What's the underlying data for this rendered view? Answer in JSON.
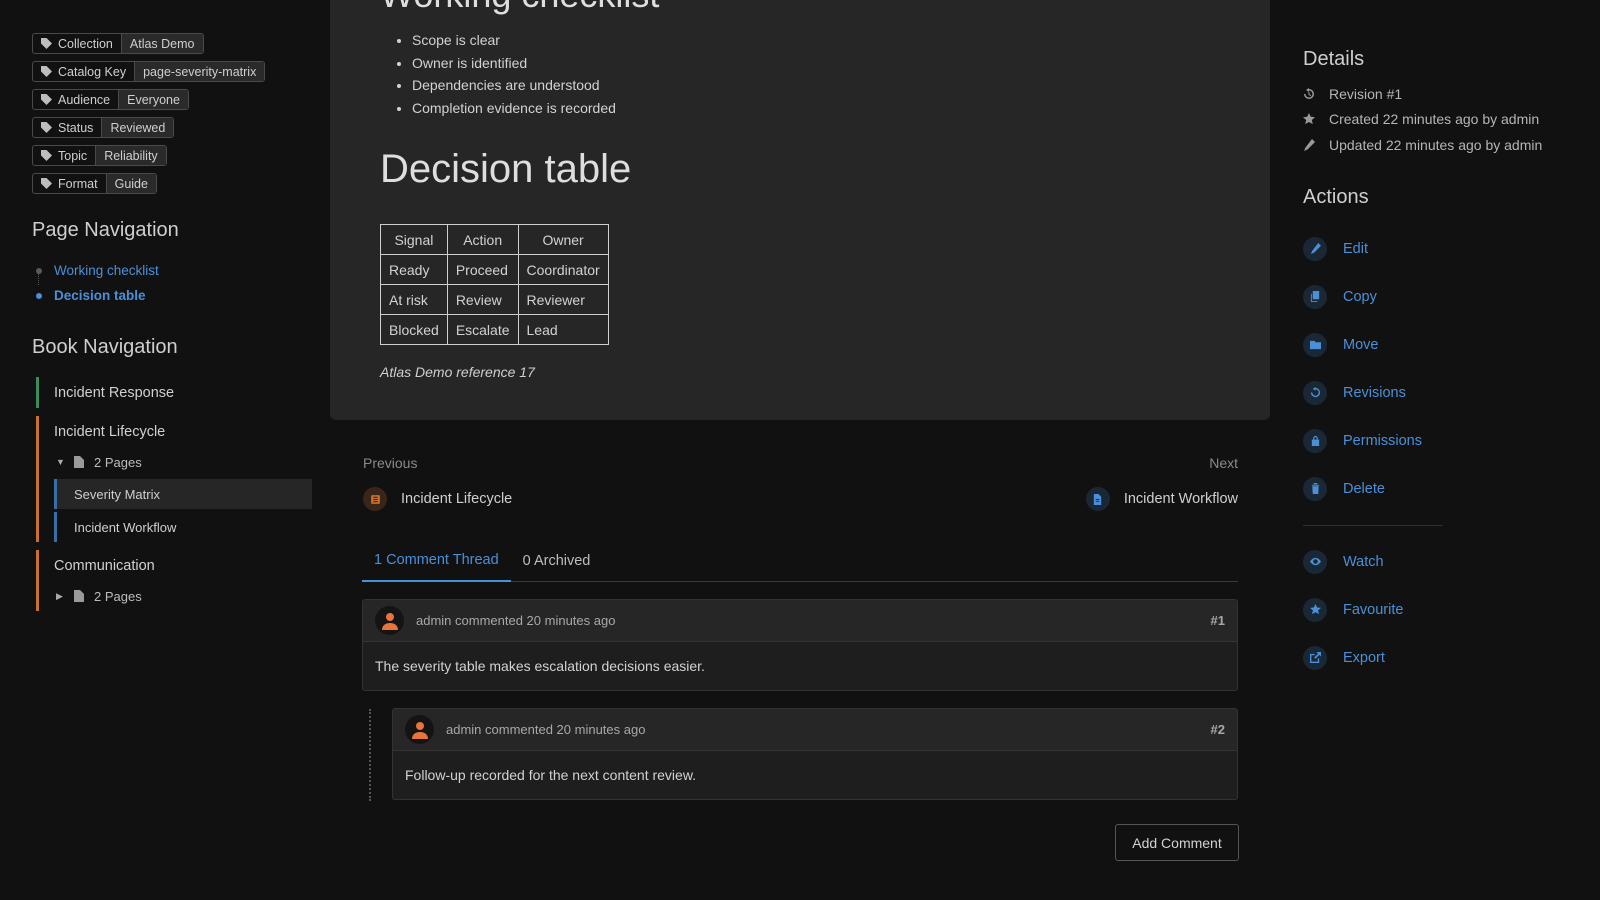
{
  "tags": [
    {
      "name": "Collection",
      "value": "Atlas Demo"
    },
    {
      "name": "Catalog Key",
      "value": "page-severity-matrix"
    },
    {
      "name": "Audience",
      "value": "Everyone"
    },
    {
      "name": "Status",
      "value": "Reviewed"
    },
    {
      "name": "Topic",
      "value": "Reliability"
    },
    {
      "name": "Format",
      "value": "Guide"
    }
  ],
  "page_navigation": {
    "heading": "Page Navigation",
    "items": [
      {
        "label": "Working checklist",
        "active": false
      },
      {
        "label": "Decision table",
        "active": true
      }
    ]
  },
  "book_navigation": {
    "heading": "Book Navigation",
    "items": [
      {
        "label": "Incident Response",
        "color": "#3f8a5a"
      },
      {
        "label": "Incident Lifecycle",
        "color": "#c8702e",
        "pages_label": "2 Pages",
        "pages": [
          "Severity Matrix",
          "Incident Workflow"
        ]
      },
      {
        "label": "Communication",
        "color": "#c8702e",
        "pages_label": "2 Pages"
      }
    ]
  },
  "content": {
    "checklist_title": "Working checklist",
    "checklist": [
      "Scope is clear",
      "Owner is identified",
      "Dependencies are understood",
      "Completion evidence is recorded"
    ],
    "decision_title": "Decision table",
    "table": {
      "headers": [
        "Signal",
        "Action",
        "Owner"
      ],
      "rows": [
        [
          "Ready",
          "Proceed",
          "Coordinator"
        ],
        [
          "At risk",
          "Review",
          "Reviewer"
        ],
        [
          "Blocked",
          "Escalate",
          "Lead"
        ]
      ]
    },
    "reference": "Atlas Demo reference 17"
  },
  "prev_next": {
    "previous_label": "Previous",
    "previous_title": "Incident Lifecycle",
    "next_label": "Next",
    "next_title": "Incident Workflow"
  },
  "comments": {
    "tabs": [
      "1 Comment Thread",
      "0 Archived"
    ],
    "items": [
      {
        "meta": "admin commented 20 minutes ago",
        "num": "#1",
        "text": "The severity table makes escalation decisions easier."
      },
      {
        "meta": "admin commented 20 minutes ago",
        "num": "#2",
        "text": "Follow-up recorded for the next content review."
      }
    ],
    "add_label": "Add Comment"
  },
  "details": {
    "heading": "Details",
    "revision": "Revision #1",
    "created": "Created 22 minutes ago by admin",
    "updated": "Updated 22 minutes ago by admin"
  },
  "actions": {
    "heading": "Actions",
    "items": [
      {
        "label": "Edit",
        "icon": "pencil-icon"
      },
      {
        "label": "Copy",
        "icon": "copy-icon"
      },
      {
        "label": "Move",
        "icon": "folder-icon"
      },
      {
        "label": "Revisions",
        "icon": "history-icon"
      },
      {
        "label": "Permissions",
        "icon": "lock-icon"
      },
      {
        "label": "Delete",
        "icon": "trash-icon"
      }
    ],
    "secondary": [
      {
        "label": "Watch",
        "icon": "eye-icon"
      },
      {
        "label": "Favourite",
        "icon": "star-icon"
      },
      {
        "label": "Export",
        "icon": "export-icon"
      }
    ]
  },
  "colors": {
    "accent": "#4a90d9",
    "background": "#111111",
    "card": "#262626",
    "avatar_orange": "#e8743b"
  }
}
